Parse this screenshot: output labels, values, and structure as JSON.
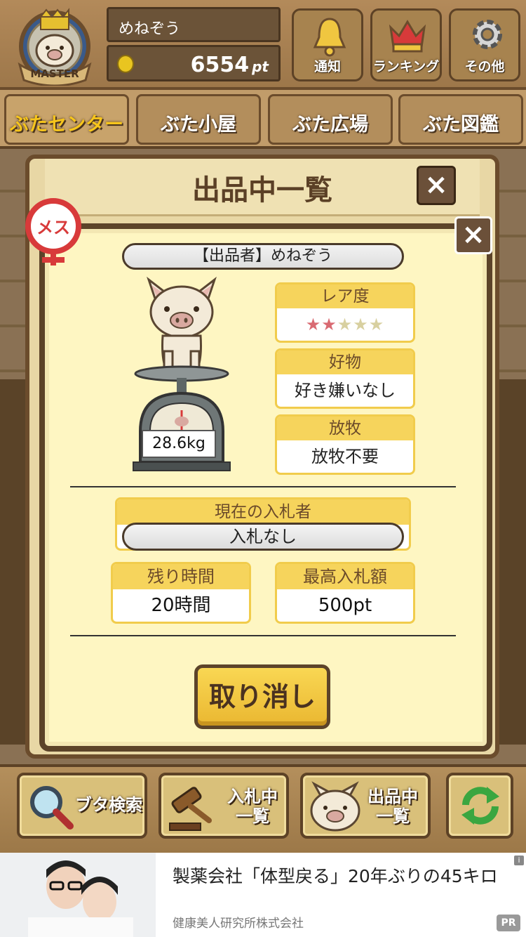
{
  "header": {
    "badge_text": "MASTER",
    "username": "めねぞう",
    "points": "6554",
    "points_unit": "pt",
    "buttons": [
      {
        "label": "通知",
        "icon": "bell-icon"
      },
      {
        "label": "ランキング",
        "icon": "crown-icon"
      },
      {
        "label": "その他",
        "icon": "gear-icon"
      }
    ]
  },
  "tabs": [
    "ぶたセンター",
    "ぶた小屋",
    "ぶた広場",
    "ぶた図鑑"
  ],
  "modal": {
    "title": "出品中一覧",
    "close": "×"
  },
  "listing": {
    "gender_badge": "メス",
    "seller": "【出品者】めねぞう",
    "weight": "28.6kg",
    "rarity_label": "レア度",
    "rarity_stars": 2,
    "rarity_max": 5,
    "favorite_label": "好物",
    "favorite_value": "好き嫌いなし",
    "grazing_label": "放牧",
    "grazing_value": "放牧不要",
    "bidder_label": "現在の入札者",
    "bidder_value": "入札なし",
    "time_label": "残り時間",
    "time_value": "20時間",
    "max_bid_label": "最高入札額",
    "max_bid_value": "500pt",
    "cancel_label": "取り消し"
  },
  "bottom": {
    "search": "ブタ検索",
    "bidding_line1": "入札中",
    "bidding_line2": "一覧",
    "listing_line1": "出品中",
    "listing_line2": "一覧"
  },
  "ad": {
    "title": "製薬会社「体型戻る」20年ぶりの45キロ",
    "sponsor": "健康美人研究所株式会社",
    "pr": "PR",
    "info": "i"
  },
  "colors": {
    "accent_yellow": "#f6d45c",
    "wood_dark": "#5c4329",
    "star_on": "#d96a72",
    "star_off": "#d8d0a0"
  }
}
